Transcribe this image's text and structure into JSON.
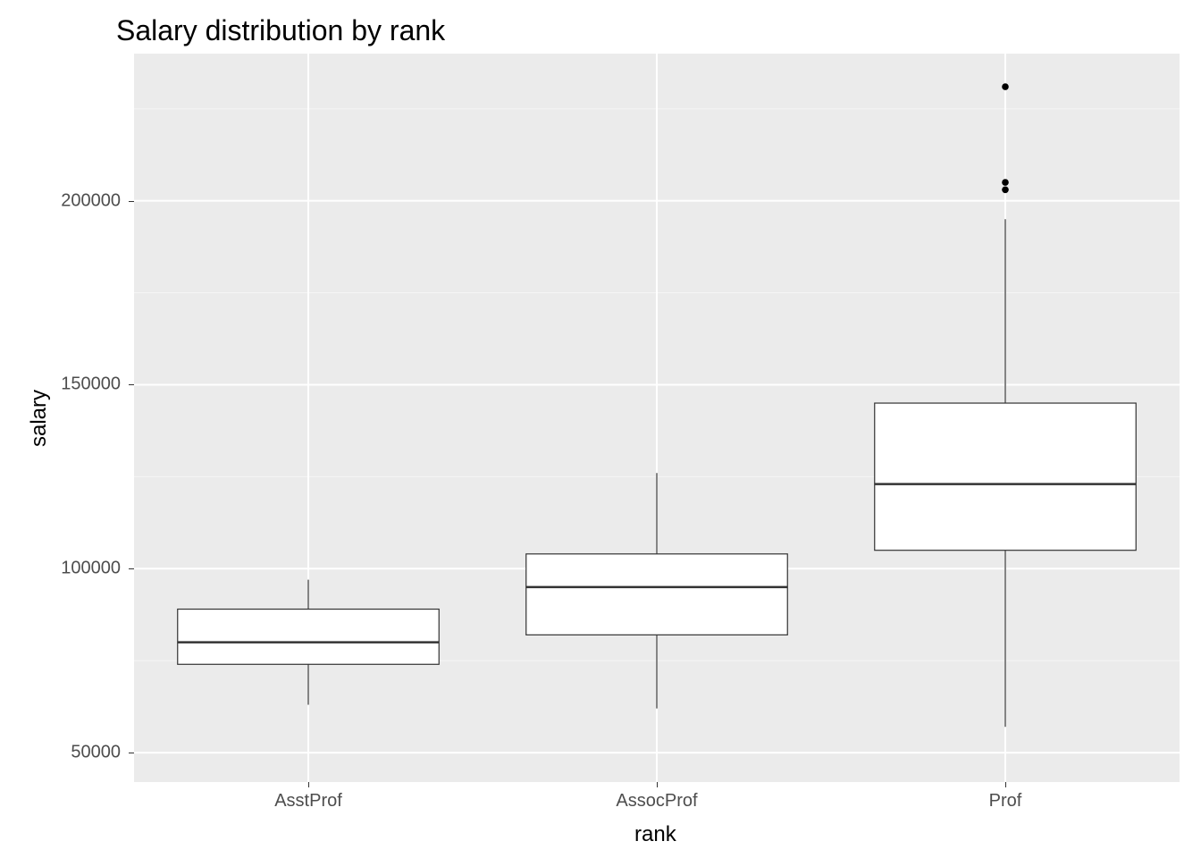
{
  "chart_data": {
    "type": "boxplot",
    "title": "Salary distribution by rank",
    "xlabel": "rank",
    "ylabel": "salary",
    "categories": [
      "AsstProf",
      "AssocProf",
      "Prof"
    ],
    "y_ticks": [
      50000,
      100000,
      150000,
      200000
    ],
    "ylim": [
      42000,
      240000
    ],
    "series": [
      {
        "name": "AsstProf",
        "lower_whisker": 63000,
        "q1": 74000,
        "median": 80000,
        "q3": 89000,
        "upper_whisker": 97000,
        "outliers": []
      },
      {
        "name": "AssocProf",
        "lower_whisker": 62000,
        "q1": 82000,
        "median": 95000,
        "q3": 104000,
        "upper_whisker": 126000,
        "outliers": []
      },
      {
        "name": "Prof",
        "lower_whisker": 57000,
        "q1": 105000,
        "median": 123000,
        "q3": 145000,
        "upper_whisker": 195000,
        "outliers": [
          203000,
          205000,
          231000
        ]
      }
    ],
    "layout": {
      "panel_bg": "#ebebeb",
      "grid_major": "#ffffff",
      "grid_minor": "#f5f5f5",
      "box_fill": "#ffffff",
      "box_stroke": "#333333",
      "median_stroke": "#333333",
      "outlier_fill": "#000000"
    }
  }
}
